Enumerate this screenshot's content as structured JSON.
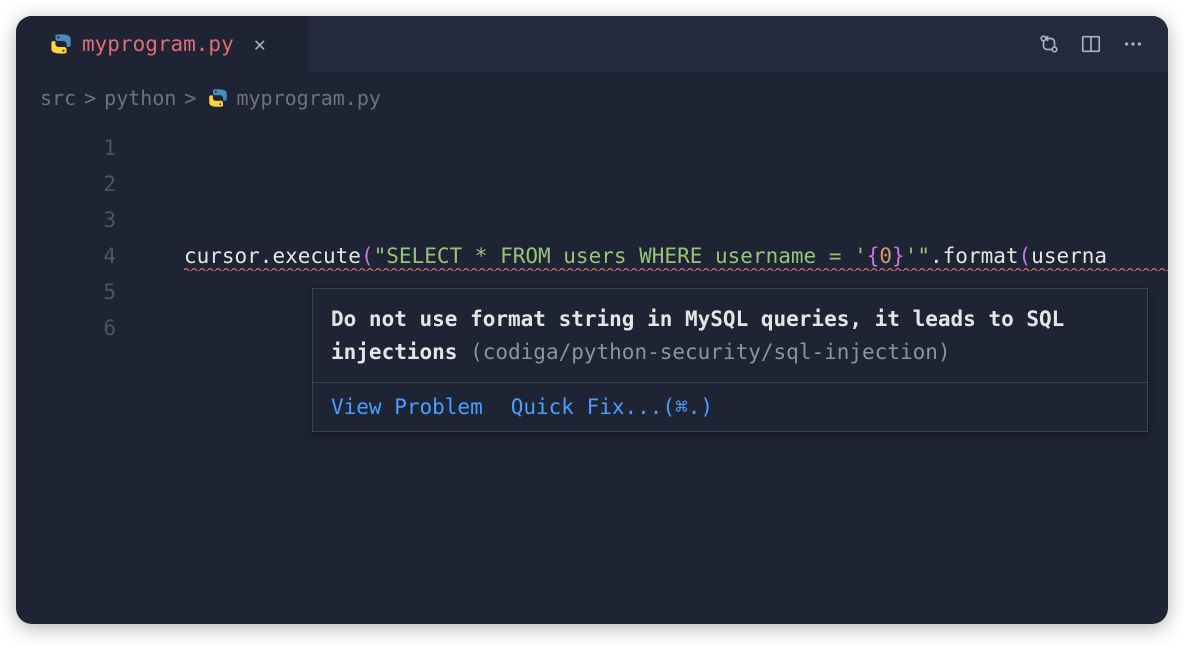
{
  "tab": {
    "filename": "myprogram.py",
    "close_glyph": "✕"
  },
  "breadcrumb": {
    "seg1": "src",
    "seg2": "python",
    "seg3": "myprogram.py",
    "sep": ">"
  },
  "gutter": {
    "lines": [
      "1",
      "2",
      "3",
      "4",
      "5",
      "6"
    ]
  },
  "code": {
    "line4": {
      "obj": "cursor",
      "dot1": ".",
      "method1": "execute",
      "lparen1": "(",
      "str_open": "\"",
      "str_body1": "SELECT * FROM users WHERE username = '",
      "str_lbrace": "{",
      "str_zero": "0",
      "str_rbrace": "}",
      "str_body2": "'",
      "str_close": "\"",
      "dot2": ".",
      "method2": "format",
      "lparen2": "(",
      "arg": "userna"
    }
  },
  "hover": {
    "message_bold": "Do not use format string in MySQL queries, it leads to SQL injections",
    "rule": "(codiga/python-security/sql-injection)",
    "view_problem": "View Problem",
    "quick_fix": "Quick Fix...(⌘.)"
  }
}
